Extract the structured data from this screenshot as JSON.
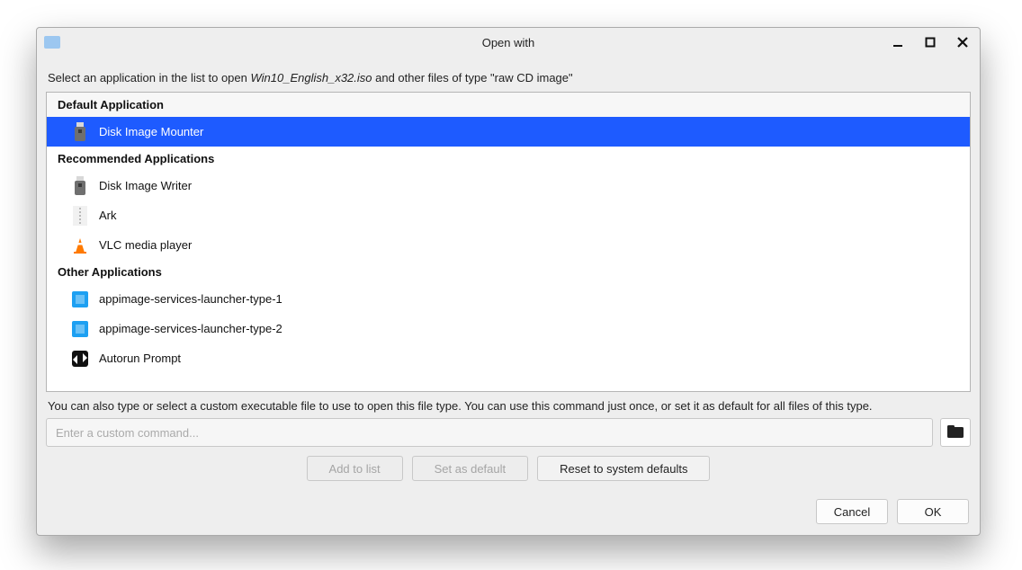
{
  "window": {
    "title": "Open with"
  },
  "prompt": {
    "prefix": "Select an application in the list to open ",
    "filename": "Win10_English_x32.iso",
    "suffix": " and other files of type \"raw CD image\""
  },
  "sections": {
    "default_label": "Default Application",
    "recommended_label": "Recommended Applications",
    "other_label": "Other Applications"
  },
  "apps": {
    "default": {
      "name": "Disk Image Mounter"
    },
    "recommended": [
      {
        "name": "Disk Image Writer"
      },
      {
        "name": "Ark"
      },
      {
        "name": "VLC media player"
      }
    ],
    "other": [
      {
        "name": "appimage-services-launcher-type-1"
      },
      {
        "name": "appimage-services-launcher-type-2"
      },
      {
        "name": "Autorun Prompt"
      }
    ]
  },
  "hint": "You can also type or select a custom executable file to use to open this file type.  You can use this command just once, or set it as default for all files of this type.",
  "command": {
    "placeholder": "Enter a custom command..."
  },
  "buttons": {
    "add": "Add to list",
    "set_default": "Set as default",
    "reset": "Reset to system defaults",
    "cancel": "Cancel",
    "ok": "OK"
  }
}
